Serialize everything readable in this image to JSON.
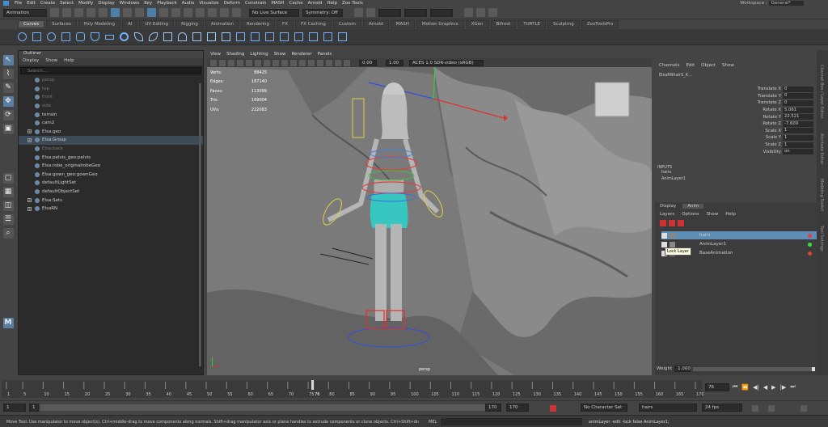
{
  "menu": [
    "File",
    "Edit",
    "Create",
    "Select",
    "Modify",
    "Display",
    "Windows",
    "Key",
    "Playback",
    "Audio",
    "Visualize",
    "Deform",
    "Constrain",
    "MASH",
    "Cache",
    "Arnold",
    "Help",
    "Zoo Tools"
  ],
  "workspace": {
    "label": "Workspace :",
    "value": "General*"
  },
  "status": {
    "mode": "Animation",
    "live_surface": "No Live Surface",
    "symmetry": "Symmetry: Off"
  },
  "shelf_tabs": [
    "Curves",
    "Surfaces",
    "Poly Modeling",
    "AI",
    "UV Editing",
    "Rigging",
    "Animation",
    "Rendering",
    "FX",
    "FX Caching",
    "Custom",
    "Arnold",
    "MASH",
    "Motion Graphics",
    "XGen",
    "Bifrost",
    "TURTLE",
    "Sculpting",
    "ZooToolsPro"
  ],
  "outliner": {
    "title": "Outliner",
    "menu": [
      "Display",
      "Show",
      "Help"
    ],
    "search_placeholder": "Search...",
    "items": [
      {
        "label": "persp",
        "dim": true,
        "exp": false
      },
      {
        "label": "top",
        "dim": true,
        "exp": false
      },
      {
        "label": "front",
        "dim": true,
        "exp": false
      },
      {
        "label": "side",
        "dim": true,
        "exp": false
      },
      {
        "label": "terrain",
        "dim": false,
        "exp": false
      },
      {
        "label": "cam2",
        "dim": false,
        "exp": false
      },
      {
        "label": "Elsa:geo",
        "dim": false,
        "exp": true
      },
      {
        "label": "Elsa:Group",
        "dim": false,
        "exp": true,
        "sel": true
      },
      {
        "label": "Elsa:back",
        "dim": true,
        "exp": false
      },
      {
        "label": "Elsa:pelvis_geo:pelvis",
        "dim": false,
        "exp": false
      },
      {
        "label": "Elsa:robe_originalrobeGeo",
        "dim": false,
        "exp": false
      },
      {
        "label": "Elsa:gown_geo:gownGeo",
        "dim": false,
        "exp": false
      },
      {
        "label": "defaultLightSet",
        "dim": false,
        "exp": false
      },
      {
        "label": "defaultObjectSet",
        "dim": false,
        "exp": false
      },
      {
        "label": "Elsa:Sets",
        "dim": false,
        "exp": true
      },
      {
        "label": "ElsaRN",
        "dim": false,
        "exp": true
      }
    ]
  },
  "viewport": {
    "menu": [
      "View",
      "Shading",
      "Lighting",
      "Show",
      "Renderer",
      "Panels"
    ],
    "exposure": "0.00",
    "gamma": "1.00",
    "colorspace": "ACES 1.0 SDR-video (sRGB)",
    "camera": "persp",
    "stats": [
      {
        "k": "Verts:",
        "v": "88425"
      },
      {
        "k": "Edges:",
        "v": "187140"
      },
      {
        "k": "Faces:",
        "v": "113099"
      },
      {
        "k": "Tris:",
        "v": "169004"
      },
      {
        "k": "UVs:",
        "v": "222083"
      }
    ]
  },
  "channelbox": {
    "menu": [
      "Channels",
      "Edit",
      "Object",
      "Show"
    ],
    "object": "ElsaRNhairS_K...",
    "channels": [
      {
        "k": "Translate X",
        "v": "0"
      },
      {
        "k": "Translate Y",
        "v": "0"
      },
      {
        "k": "Translate Z",
        "v": "0"
      },
      {
        "k": "Rotate X",
        "v": "5.061"
      },
      {
        "k": "Rotate Y",
        "v": "22.521"
      },
      {
        "k": "Rotate Z",
        "v": "-7.609"
      },
      {
        "k": "Scale X",
        "v": "1"
      },
      {
        "k": "Scale Y",
        "v": "1"
      },
      {
        "k": "Scale Z",
        "v": "1"
      },
      {
        "k": "Visibility",
        "v": "on"
      }
    ],
    "inputs_title": "INPUTS",
    "inputs": [
      "hairs",
      "AnimLayer1"
    ]
  },
  "animlayers": {
    "tabs": [
      "Display",
      "Anim"
    ],
    "menu": [
      "Layers",
      "Options",
      "Show",
      "Help"
    ],
    "layers": [
      {
        "name": "hairs",
        "dot": "#e04040"
      },
      {
        "name": "AnimLayer1",
        "dot": "#40e040"
      },
      {
        "name": "BaseAnimation",
        "dot": "#e04040"
      }
    ],
    "tooltip": "Lock Layer",
    "weight_label": "Weight",
    "weight": "1.000"
  },
  "side_tabs": [
    "Channel Box / Layer Editor",
    "Attribute Editor",
    "Modeling Toolkit",
    "Tool Settings"
  ],
  "timeline": {
    "ticks": [
      "1",
      "5",
      "10",
      "15",
      "20",
      "25",
      "30",
      "35",
      "40",
      "45",
      "50",
      "55",
      "60",
      "65",
      "70",
      "75",
      "80",
      "85",
      "90",
      "95",
      "100",
      "105",
      "110",
      "115",
      "120",
      "125",
      "130",
      "135",
      "140",
      "145",
      "150",
      "155",
      "160",
      "165",
      "170"
    ],
    "current": "76",
    "current_field": "76"
  },
  "range": {
    "start": "1",
    "start2": "1",
    "end_inner": "170",
    "end": "170",
    "char_set": "No Character Set",
    "anim_layer": "hairs",
    "fps": "24 fps"
  },
  "help": {
    "mel": "MEL",
    "text": "Move Tool: Use manipulator to move object(s). Ctrl+middle-drag to move components along normals. Shift+drag manipulator axis or plane handles to extrude components or clone objects. Ctrl+Shift+drag to con",
    "result": "animLayer -edit -lock false AnimLayer1;"
  },
  "colors": {
    "accent": "#4d7ea6",
    "select": "#5e8db5"
  }
}
